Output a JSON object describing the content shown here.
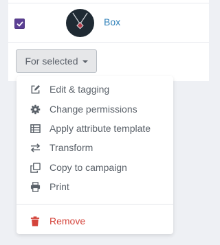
{
  "row": {
    "checked": true,
    "name": "Box"
  },
  "toolbar": {
    "for_selected_label": "For selected"
  },
  "menu": {
    "items": [
      {
        "label": "Edit & tagging",
        "icon": "edit-icon"
      },
      {
        "label": "Change permissions",
        "icon": "gear-icon"
      },
      {
        "label": "Apply attribute template",
        "icon": "list-table-icon"
      },
      {
        "label": "Transform",
        "icon": "transform-arrows-icon"
      },
      {
        "label": "Copy to campaign",
        "icon": "copy-icon"
      },
      {
        "label": "Print",
        "icon": "print-icon"
      }
    ],
    "remove": {
      "label": "Remove",
      "icon": "trash-icon"
    }
  },
  "colors": {
    "accent_link": "#2d7fb8",
    "checkbox": "#5b3f94",
    "danger": "#d4443b"
  }
}
